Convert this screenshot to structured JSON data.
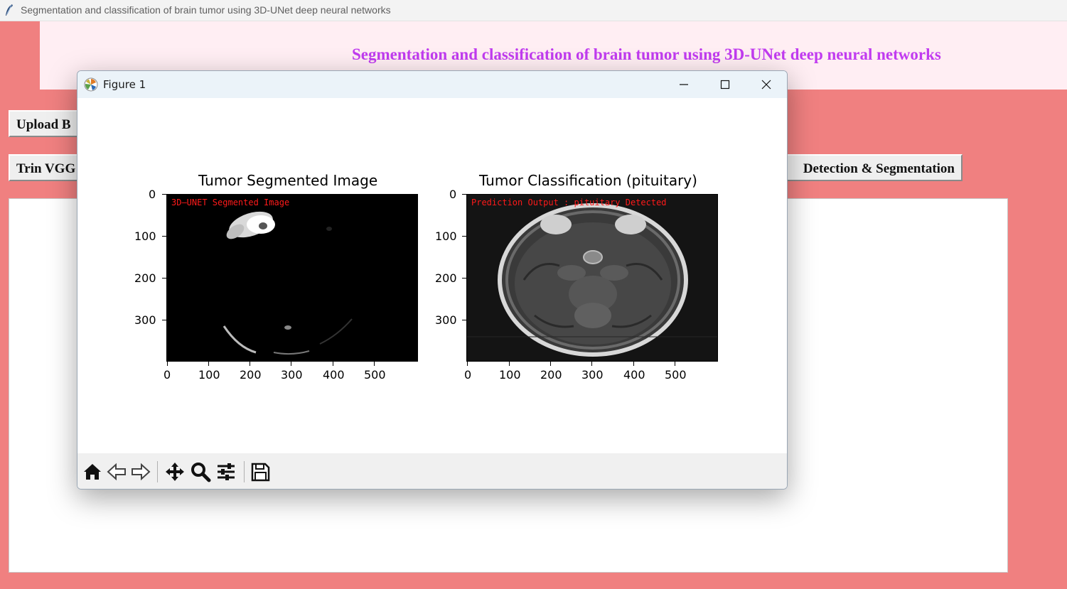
{
  "window": {
    "title": "Segmentation and classification of brain tumor using 3D-UNet deep neural networks"
  },
  "header": {
    "heading": "Segmentation and classification of brain tumor using 3D-UNet deep neural networks"
  },
  "buttons": {
    "upload_label": "Upload B",
    "train_label": "Trin VGG",
    "detect_label": "Detection & Segmentation"
  },
  "figure": {
    "title": "Figure 1",
    "left_axes": {
      "title": "Tumor Segmented Image",
      "overlay": "3D–UNET Segmented Image"
    },
    "right_axes": {
      "title": "Tumor Classification (pituitary)",
      "overlay": "Prediction Output : pituitary Detected"
    },
    "x_ticks": [
      "0",
      "100",
      "200",
      "300",
      "400",
      "500"
    ],
    "y_ticks": [
      "0",
      "100",
      "200",
      "300"
    ]
  },
  "toolbar": {
    "icons": [
      "home-icon",
      "back-icon",
      "forward-icon",
      "pan-icon",
      "zoom-icon",
      "configure-subplots-icon",
      "save-icon"
    ]
  },
  "colors": {
    "background": "#f08080",
    "heading": "#c13bf0",
    "header_band": "#ffeef3",
    "overlay_text": "#ff1a1a"
  }
}
